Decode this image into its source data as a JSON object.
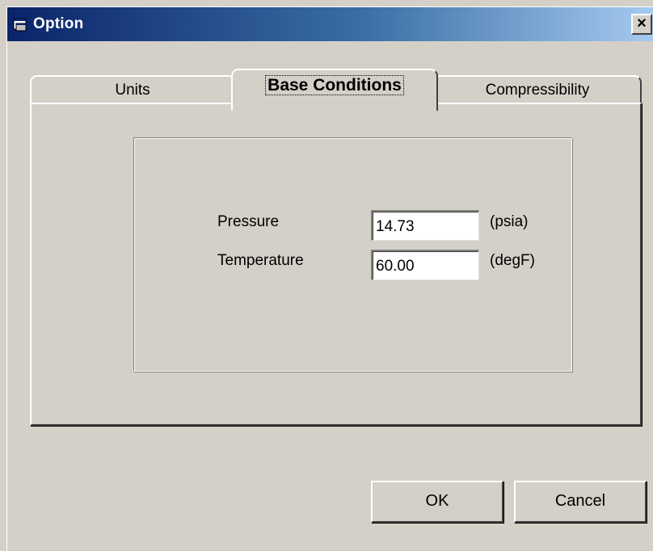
{
  "window": {
    "title": "Option",
    "close_label": "×"
  },
  "tabs": [
    {
      "label": "Units"
    },
    {
      "label": "Base Conditions"
    },
    {
      "label": "Compressibility"
    }
  ],
  "fields": {
    "pressure": {
      "label": "Pressure",
      "value": "14.73",
      "unit": "(psia)"
    },
    "temperature": {
      "label": "Temperature",
      "value": "60.00",
      "unit": "(degF)"
    }
  },
  "buttons": {
    "ok": "OK",
    "cancel": "Cancel"
  },
  "colors": {
    "titlebar_start": "#0a246a",
    "titlebar_end": "#a6caf0",
    "face": "#d4d0c8"
  }
}
